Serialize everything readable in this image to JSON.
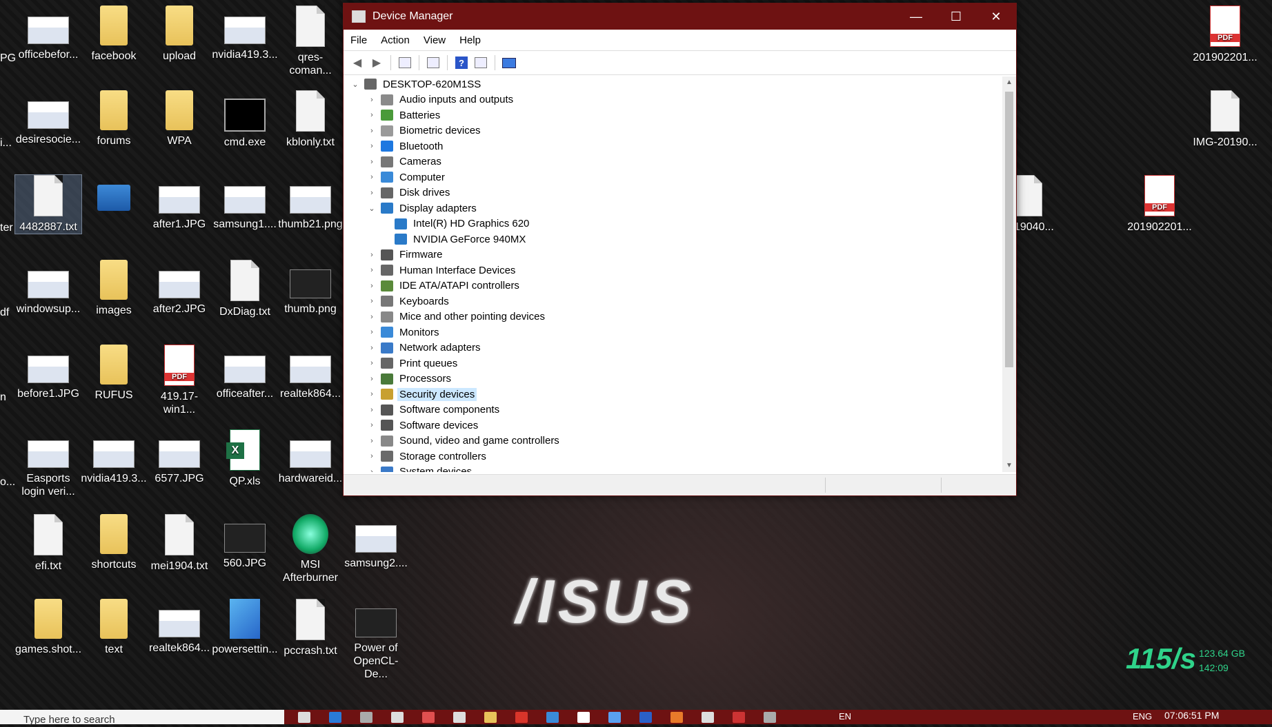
{
  "desktop": {
    "icons": [
      {
        "label": "officebefor...",
        "type": "img"
      },
      {
        "label": "facebook",
        "type": "folder"
      },
      {
        "label": "upload",
        "type": "folder"
      },
      {
        "label": "nvidia419.3...",
        "type": "img"
      },
      {
        "label": "qres-coman...",
        "type": "file"
      },
      {
        "label": "desiresocie...",
        "type": "img"
      },
      {
        "label": "forums",
        "type": "folder"
      },
      {
        "label": "WPA",
        "type": "folder"
      },
      {
        "label": "cmd.exe",
        "type": "cmd"
      },
      {
        "label": "kblonly.txt",
        "type": "file"
      },
      {
        "label": "4482887.txt",
        "type": "file"
      },
      {
        "label": "",
        "type": "dash"
      },
      {
        "label": "after1.JPG",
        "type": "img"
      },
      {
        "label": "samsung1....",
        "type": "img"
      },
      {
        "label": "thumb21.png",
        "type": "img"
      },
      {
        "label": "windowsup...",
        "type": "img"
      },
      {
        "label": "images",
        "type": "folder"
      },
      {
        "label": "after2.JPG",
        "type": "img"
      },
      {
        "label": "DxDiag.txt",
        "type": "file"
      },
      {
        "label": "thumb.png",
        "type": "dark"
      },
      {
        "label": "before1.JPG",
        "type": "img"
      },
      {
        "label": "RUFUS",
        "type": "folder"
      },
      {
        "label": "419.17-win1...",
        "type": "pdf"
      },
      {
        "label": "officeafter...",
        "type": "img"
      },
      {
        "label": "realtek864...",
        "type": "img"
      },
      {
        "label": "Easports login veri...",
        "type": "img"
      },
      {
        "label": "nvidia419.3...",
        "type": "img"
      },
      {
        "label": "6577.JPG",
        "type": "img"
      },
      {
        "label": "QP.xls",
        "type": "xls"
      },
      {
        "label": "hardwareid...",
        "type": "img"
      },
      {
        "label": "efi.txt",
        "type": "file"
      },
      {
        "label": "shortcuts",
        "type": "folder"
      },
      {
        "label": "mei1904.txt",
        "type": "file"
      },
      {
        "label": "560.JPG",
        "type": "dark"
      },
      {
        "label": "MSI Afterburner",
        "type": "app"
      },
      {
        "label": "samsung2....",
        "type": "img"
      },
      {
        "label": "games.shot...",
        "type": "folder"
      },
      {
        "label": "text",
        "type": "folder"
      },
      {
        "label": "realtek864...",
        "type": "img"
      },
      {
        "label": "powersettin...",
        "type": "reg"
      },
      {
        "label": "pccrash.txt",
        "type": "file"
      },
      {
        "label": "Power of OpenCL- De...",
        "type": "dark"
      },
      {
        "label": "201902201...",
        "type": "pdf"
      },
      {
        "label": "IMG-20190...",
        "type": "file"
      },
      {
        "label": "2019040...",
        "type": "file"
      },
      {
        "label": "201902201...",
        "type": "pdf"
      }
    ],
    "left_clipped": [
      "PG",
      "i...",
      "ter",
      "df",
      "n",
      "o..."
    ],
    "pdf_badge": "PDF",
    "brand_logo": "/ISUS",
    "netspeed": {
      "rate": "115/s",
      "total": "123.64 GB",
      "time": "142:09"
    }
  },
  "window": {
    "title": "Device Manager",
    "controls": {
      "minimize": "—",
      "maximize": "☐",
      "close": "✕"
    },
    "menu": [
      "File",
      "Action",
      "View",
      "Help"
    ],
    "tree": {
      "root": "DESKTOP-620M1SS",
      "items": [
        {
          "label": "Audio inputs and outputs",
          "color": "#8a8a8a"
        },
        {
          "label": "Batteries",
          "color": "#4a9a3a"
        },
        {
          "label": "Biometric devices",
          "color": "#9a9a9a"
        },
        {
          "label": "Bluetooth",
          "color": "#1e78e0"
        },
        {
          "label": "Cameras",
          "color": "#777777"
        },
        {
          "label": "Computer",
          "color": "#3a8ad8"
        },
        {
          "label": "Disk drives",
          "color": "#666666"
        },
        {
          "label": "Display adapters",
          "color": "#2a7ac8",
          "expanded": true,
          "children": [
            {
              "label": "Intel(R) HD Graphics 620",
              "color": "#2a7ac8"
            },
            {
              "label": "NVIDIA GeForce 940MX",
              "color": "#2a7ac8"
            }
          ]
        },
        {
          "label": "Firmware",
          "color": "#555555"
        },
        {
          "label": "Human Interface Devices",
          "color": "#666666"
        },
        {
          "label": "IDE ATA/ATAPI controllers",
          "color": "#5a8a3a"
        },
        {
          "label": "Keyboards",
          "color": "#777777"
        },
        {
          "label": "Mice and other pointing devices",
          "color": "#888888"
        },
        {
          "label": "Monitors",
          "color": "#3a8ad8"
        },
        {
          "label": "Network adapters",
          "color": "#3a7ac8"
        },
        {
          "label": "Print queues",
          "color": "#666666"
        },
        {
          "label": "Processors",
          "color": "#4a7a3a"
        },
        {
          "label": "Security devices",
          "color": "#c8a030",
          "selected": true
        },
        {
          "label": "Software components",
          "color": "#555555"
        },
        {
          "label": "Software devices",
          "color": "#555555"
        },
        {
          "label": "Sound, video and game controllers",
          "color": "#888888"
        },
        {
          "label": "Storage controllers",
          "color": "#6a6a6a"
        },
        {
          "label": "System devices",
          "color": "#3a7ac8"
        }
      ]
    }
  },
  "taskbar": {
    "search_placeholder": "Type here to search",
    "clock_time": "07:06:51 PM",
    "language": "EN",
    "lang_suffix": "ENG"
  }
}
